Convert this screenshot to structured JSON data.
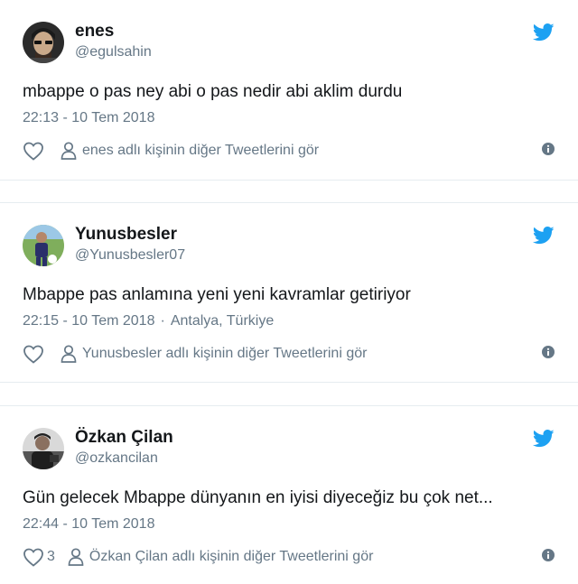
{
  "tweets": [
    {
      "name": "enes",
      "handle": "@egulsahin",
      "text": "mbappe o pas ney abi o pas nedir abi aklim durdu",
      "time": "22:13 - 10 Tem 2018",
      "location": "",
      "likes": "",
      "more_link": "enes adlı kişinin diğer Tweetlerini gör",
      "icons": {
        "logo": "twitter-bird-icon",
        "like": "heart-icon",
        "profile": "person-icon",
        "info": "info-icon"
      }
    },
    {
      "name": "Yunusbesler",
      "handle": "@Yunusbesler07",
      "text": "Mbappe pas anlamına yeni yeni kavramlar getiriyor",
      "time": "22:15 - 10 Tem 2018",
      "location": "Antalya, Türkiye",
      "likes": "",
      "more_link": "Yunusbesler adlı kişinin diğer Tweetlerini gör",
      "icons": {
        "logo": "twitter-bird-icon",
        "like": "heart-icon",
        "profile": "person-icon",
        "info": "info-icon"
      }
    },
    {
      "name": "Özkan Çilan",
      "handle": "@ozkancilan",
      "text": "Gün gelecek Mbappe dünyanın en iyisi diyeceğiz bu çok net...",
      "time": "22:44 - 10 Tem 2018",
      "location": "",
      "likes": "3",
      "more_link": "Özkan Çilan adlı kişinin diğer Tweetlerini gör",
      "icons": {
        "logo": "twitter-bird-icon",
        "like": "heart-icon",
        "profile": "person-icon",
        "info": "info-icon"
      }
    }
  ],
  "colors": {
    "twitter_blue": "#1da1f2",
    "secondary_text": "#657786",
    "primary_text": "#14171a",
    "divider": "#e6ecf0"
  }
}
